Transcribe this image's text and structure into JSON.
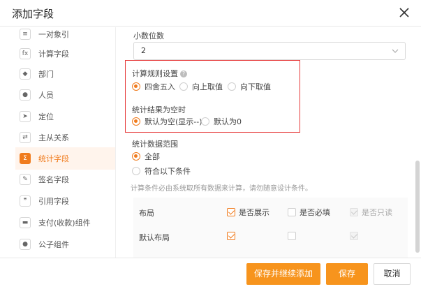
{
  "dialog": {
    "title": "添加字段"
  },
  "sidebar": {
    "items": [
      {
        "label": "一对象引",
        "icon": "link-icon",
        "glyph": "≡"
      },
      {
        "label": "计算字段",
        "icon": "formula-icon",
        "glyph": "fx"
      },
      {
        "label": "部门",
        "icon": "org-icon",
        "glyph": "◆"
      },
      {
        "label": "人员",
        "icon": "person-icon",
        "glyph": "●"
      },
      {
        "label": "定位",
        "icon": "location-icon",
        "glyph": "➤"
      },
      {
        "label": "主从关系",
        "icon": "relation-icon",
        "glyph": "⇄"
      },
      {
        "label": "统计字段",
        "icon": "stat-icon",
        "glyph": "Σ",
        "active": true
      },
      {
        "label": "签名字段",
        "icon": "signature-icon",
        "glyph": "✎"
      },
      {
        "label": "引用字段",
        "icon": "quote-icon",
        "glyph": "❞"
      },
      {
        "label": "支付(收款)组件",
        "icon": "payment-icon",
        "glyph": "▬"
      },
      {
        "label": "公子组件",
        "icon": "component-icon",
        "glyph": "●"
      }
    ]
  },
  "form": {
    "decimal_label": "小数位数",
    "decimal_value": "2",
    "rounding_label": "计算规则设置",
    "rounding_options": [
      "四舍五入",
      "向上取值",
      "向下取值"
    ],
    "rounding_selected": "四舍五入",
    "empty_label": "统计结果为空时",
    "empty_options": [
      "默认为空(显示--)",
      "默认为0"
    ],
    "empty_selected": "默认为空(显示--)",
    "scope_label": "统计数据范围",
    "scope_options": [
      "全部",
      "符合以下条件"
    ],
    "scope_selected": "全部",
    "hint": "计算条件必由系统取所有数据来计算，请勿随意设计条件。",
    "layout": {
      "label": "布局",
      "default_label": "默认布局",
      "show_label": "是否展示",
      "required_label": "是否必填",
      "readonly_label": "是否只读"
    }
  },
  "footer": {
    "save_continue": "保存并继续添加",
    "save": "保存",
    "cancel": "取消"
  },
  "colors": {
    "accent": "#f07b1d",
    "button": "#f7941d",
    "highlight_box": "#e63838"
  }
}
